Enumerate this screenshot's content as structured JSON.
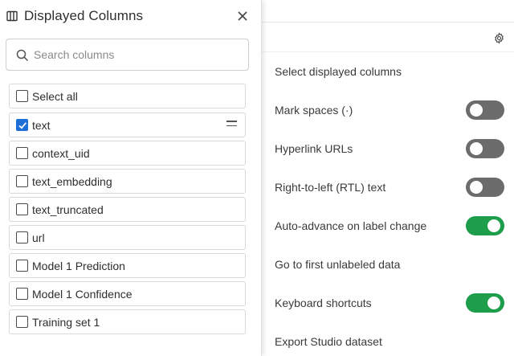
{
  "panel": {
    "title": "Displayed Columns",
    "search_placeholder": "Search columns",
    "select_all_label": "Select all",
    "columns": [
      {
        "label": "text",
        "checked": true
      },
      {
        "label": "context_uid",
        "checked": false
      },
      {
        "label": "text_embedding",
        "checked": false
      },
      {
        "label": "text_truncated",
        "checked": false
      },
      {
        "label": "url",
        "checked": false
      },
      {
        "label": "Model 1 Prediction",
        "checked": false
      },
      {
        "label": "Model 1 Confidence",
        "checked": false
      },
      {
        "label": "Training set 1",
        "checked": false
      }
    ]
  },
  "settings_menu": {
    "items": [
      {
        "label": "Select displayed columns"
      },
      {
        "label": "Mark spaces (·)",
        "toggle": "off"
      },
      {
        "label": "Hyperlink URLs",
        "toggle": "off"
      },
      {
        "label": "Right-to-left (RTL) text",
        "toggle": "off"
      },
      {
        "label": "Auto-advance on label change",
        "toggle": "on"
      },
      {
        "label": "Go to first unlabeled data"
      },
      {
        "label": "Keyboard shortcuts",
        "toggle": "on"
      },
      {
        "label": "Export Studio dataset"
      }
    ]
  },
  "icons": {
    "columns": "columns-icon",
    "close": "close-icon",
    "search": "search-icon",
    "gear": "gear-icon",
    "drag": "drag-handle-icon"
  },
  "colors": {
    "accent_blue": "#1f6fd8",
    "toggle_on": "#1e9e4a",
    "toggle_off": "#6c6c6c"
  }
}
